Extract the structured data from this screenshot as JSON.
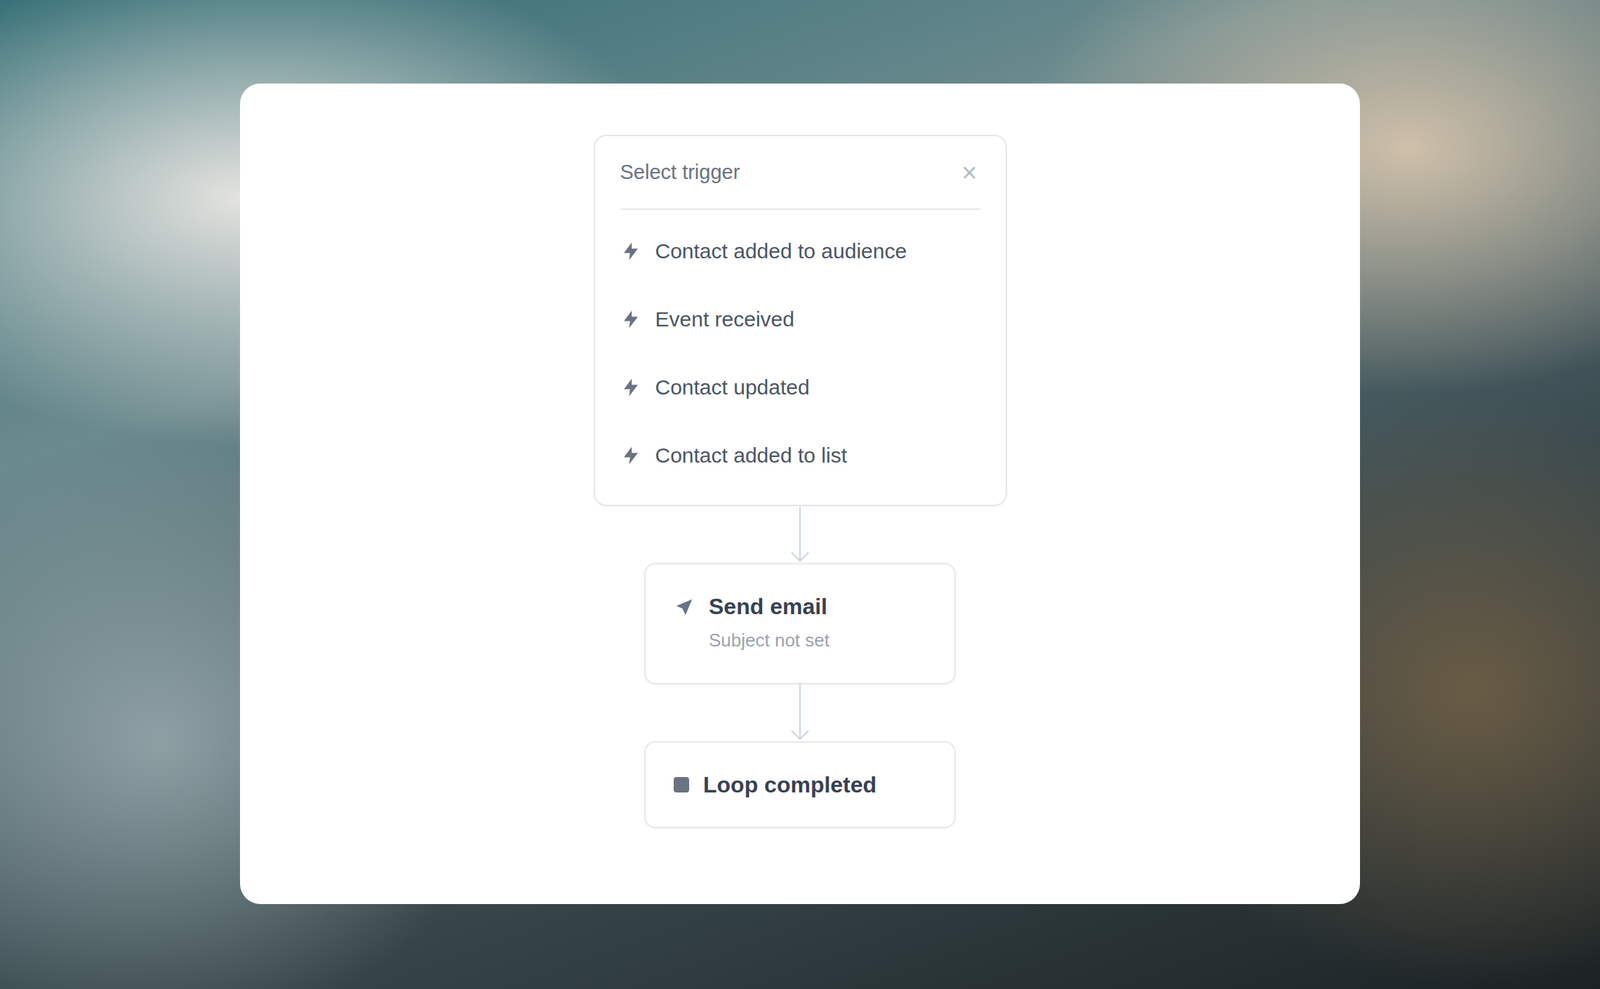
{
  "trigger_panel": {
    "title": "Select trigger",
    "close": "×",
    "items": [
      "Contact added to audience",
      "Event received",
      "Contact updated",
      "Contact added to list"
    ]
  },
  "steps": [
    {
      "kind": "action",
      "title": "Send email",
      "subtitle": "Subject not set"
    },
    {
      "kind": "end",
      "title": "Loop completed"
    }
  ]
}
